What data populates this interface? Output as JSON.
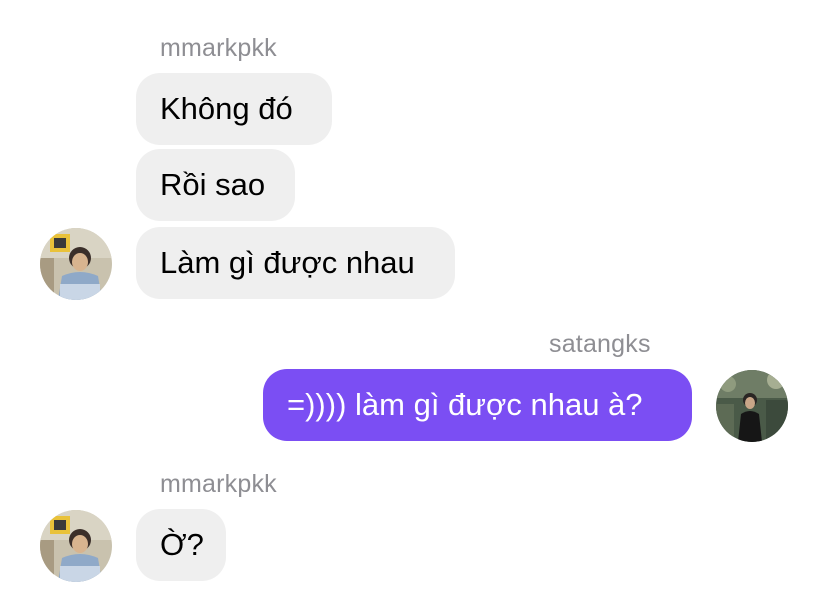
{
  "groups": [
    {
      "sender": "mmarkpkk",
      "messages": [
        "Không đó",
        "Rồi sao",
        "Làm gì được nhau"
      ]
    },
    {
      "sender": "satangks",
      "messages": [
        "=)))) làm gì được nhau à?"
      ]
    },
    {
      "sender": "mmarkpkk",
      "messages": [
        "Ờ?"
      ]
    }
  ],
  "avatars": {
    "mmarkpkk": "user-avatar-photo",
    "satangks": "user-avatar-photo"
  },
  "colors": {
    "incoming_bubble": "#efefef",
    "outgoing_bubble": "#7b4ef3",
    "sender_name": "#8e8e93"
  }
}
